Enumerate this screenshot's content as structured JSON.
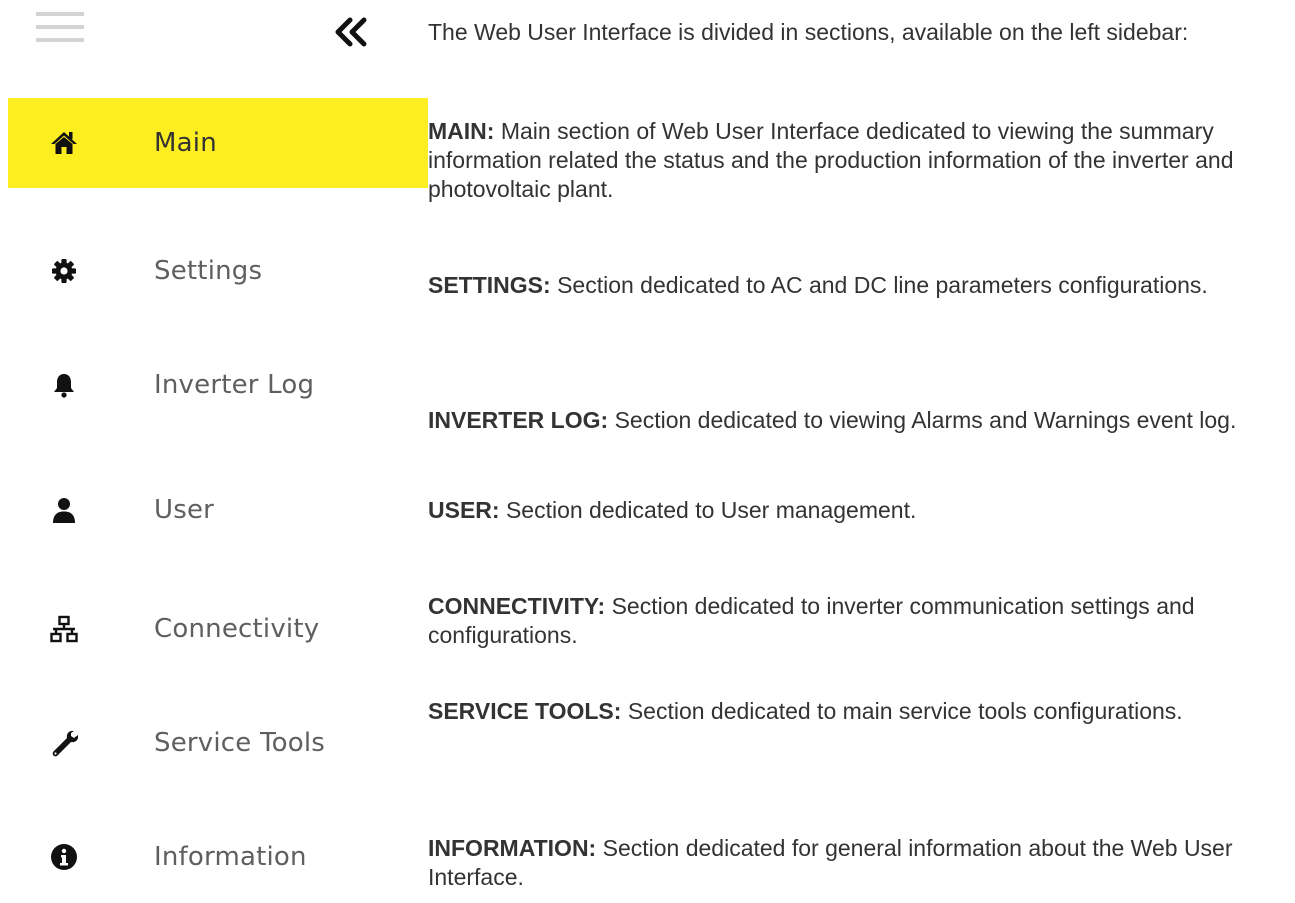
{
  "intro": "The Web User Interface is divided in sections, available on the left sidebar:",
  "colors": {
    "active_bg": "#fcee21",
    "icon": "#111111",
    "label": "#5f5f5f",
    "hamburger": "#d4d4d4"
  },
  "toolbar": {
    "menu_icon": "hamburger-icon",
    "collapse_icon": "double-chevron-left-icon"
  },
  "sidebar": {
    "items": [
      {
        "label": "Main",
        "icon": "home-icon",
        "active": true
      },
      {
        "label": "Settings",
        "icon": "gear-icon"
      },
      {
        "label": "Inverter Log",
        "icon": "bell-icon"
      },
      {
        "label": "User",
        "icon": "user-icon"
      },
      {
        "label": "Connectivity",
        "icon": "network-icon"
      },
      {
        "label": "Service Tools",
        "icon": "wrench-icon"
      },
      {
        "label": "Information",
        "icon": "info-icon"
      }
    ]
  },
  "descriptions": [
    {
      "title": "MAIN:",
      "text": "Main section of Web User Interface dedicated to viewing the summary information related the status and the production information of the inverter and photovoltaic plant."
    },
    {
      "title": "SETTINGS:",
      "text": "Section dedicated to AC and DC line parameters configurations."
    },
    {
      "title": "INVERTER LOG:",
      "text": "Section dedicated to viewing Alarms and Warnings event log."
    },
    {
      "title": "USER:",
      "text": "Section dedicated to User management."
    },
    {
      "title": "CONNECTIVITY:",
      "text": "Section dedicated to inverter communication settings and configurations."
    },
    {
      "title": "SERVICE TOOLS:",
      "text": "Section dedicated to main service tools configurations."
    },
    {
      "title": "INFORMATION:",
      "text": "Section dedicated for general information about the Web User Interface."
    }
  ]
}
